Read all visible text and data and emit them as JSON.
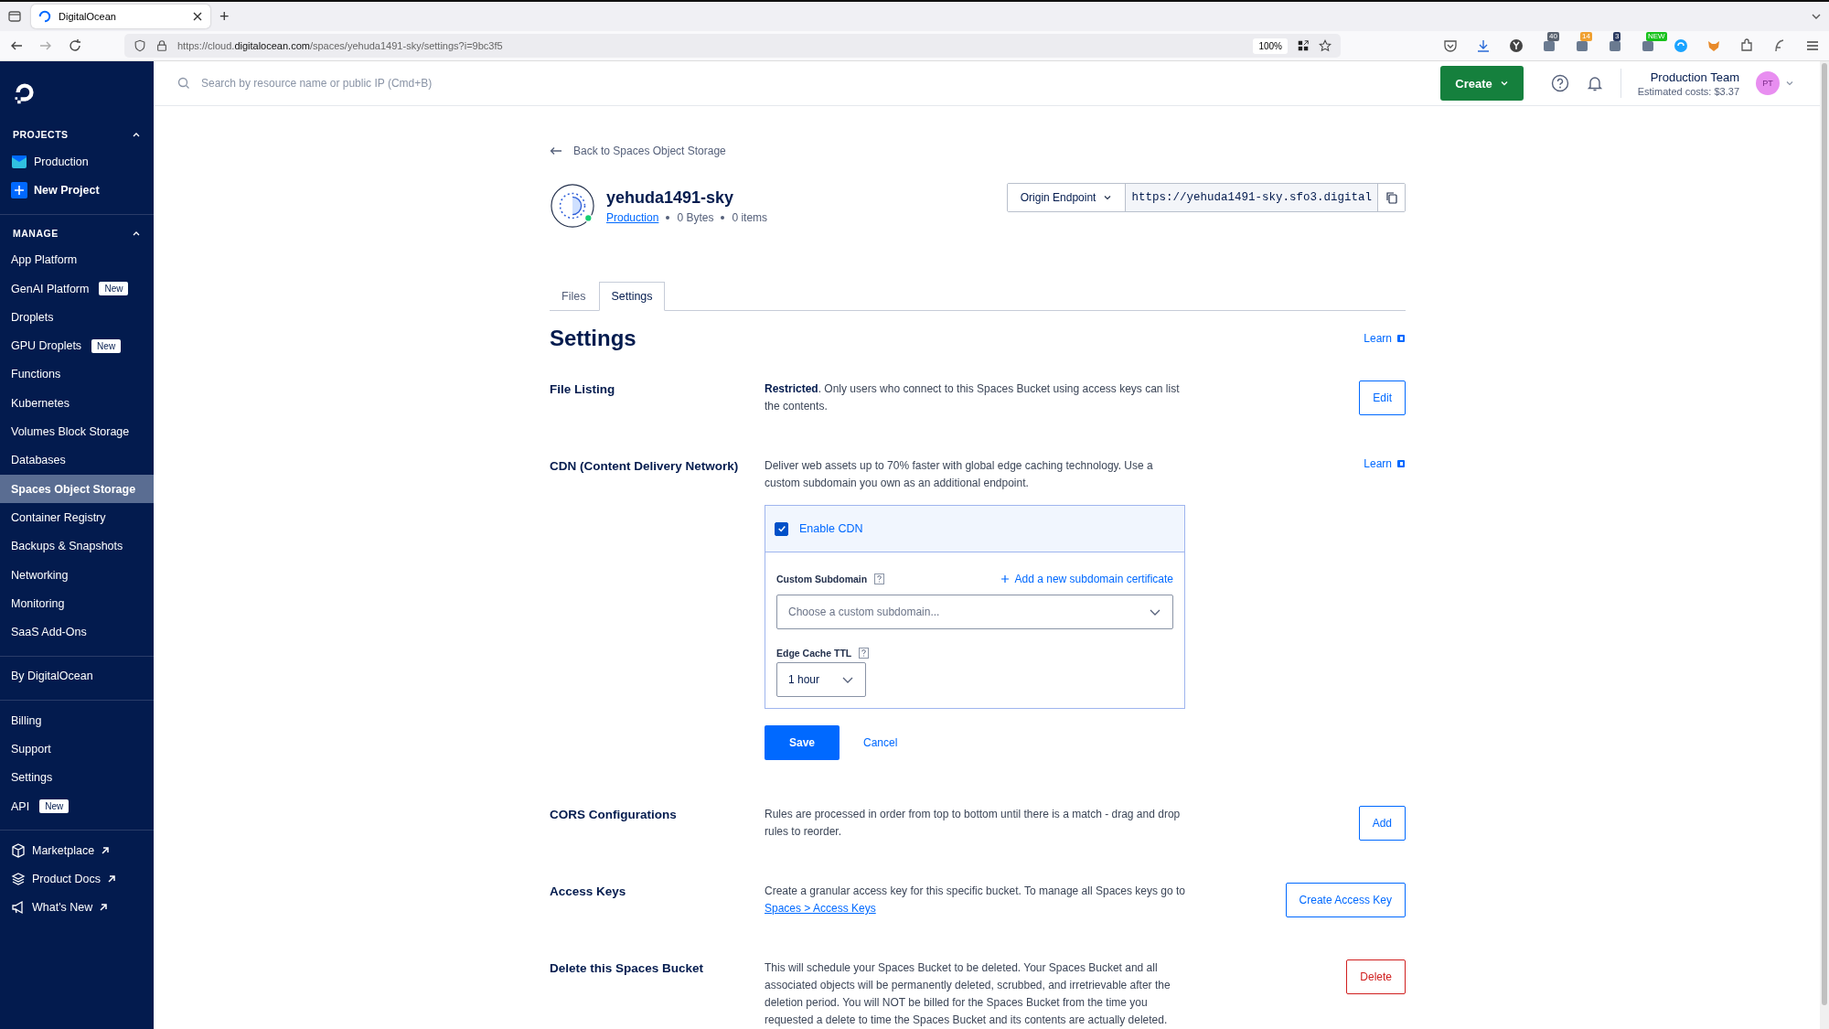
{
  "browser": {
    "tab_title": "DigitalOcean",
    "new_tab": "+",
    "url_prefix": "https://cloud.",
    "url_domain": "digitalocean.com",
    "url_path": "/spaces/yehuda1491-sky/settings?i=9bc3f5",
    "zoom": "100%",
    "extension_badges": [
      {
        "text": "40",
        "color": "#5a6370"
      },
      {
        "text": "14",
        "color": "#f0a030"
      },
      {
        "text": "3",
        "color": "#2a3a60"
      },
      {
        "text": "NEW",
        "color": "#18c21c"
      }
    ]
  },
  "sidebar": {
    "groups": [
      {
        "title": "PROJECTS",
        "expanded": true,
        "items": [
          {
            "label": "Production",
            "kind": "project",
            "selected": false
          },
          {
            "label": "New Project",
            "kind": "new",
            "selected": false
          }
        ]
      },
      {
        "title": "MANAGE",
        "expanded": true,
        "items": [
          {
            "label": "App Platform",
            "selected": false
          },
          {
            "label": "GenAI Platform",
            "badge": "New",
            "selected": false
          },
          {
            "label": "Droplets",
            "selected": false
          },
          {
            "label": "GPU Droplets",
            "badge": "New",
            "selected": false
          },
          {
            "label": "Functions",
            "selected": false
          },
          {
            "label": "Kubernetes",
            "selected": false
          },
          {
            "label": "Volumes Block Storage",
            "selected": false
          },
          {
            "label": "Databases",
            "selected": false
          },
          {
            "label": "Spaces Object Storage",
            "selected": true
          },
          {
            "label": "Container Registry",
            "selected": false
          },
          {
            "label": "Backups & Snapshots",
            "selected": false
          },
          {
            "label": "Networking",
            "selected": false
          },
          {
            "label": "Monitoring",
            "selected": false
          },
          {
            "label": "SaaS Add-Ons",
            "selected": false
          }
        ]
      },
      {
        "items": [
          {
            "label": "By DigitalOcean",
            "selected": false
          }
        ]
      },
      {
        "items": [
          {
            "label": "Billing",
            "selected": false
          },
          {
            "label": "Support",
            "selected": false
          },
          {
            "label": "Settings",
            "selected": false
          },
          {
            "label": "API",
            "badge": "New",
            "selected": false
          }
        ]
      },
      {
        "items": [
          {
            "label": "Marketplace",
            "kind": "marketplace",
            "external": true,
            "selected": false
          },
          {
            "label": "Product Docs",
            "kind": "docs",
            "external": true,
            "selected": false
          },
          {
            "label": "What's New",
            "kind": "news",
            "external": true,
            "selected": false
          }
        ]
      }
    ]
  },
  "header": {
    "search_placeholder": "Search by resource name or public IP (Cmd+B)",
    "create_button": "Create",
    "team": "Production Team",
    "costs": "Estimated costs: $3.37",
    "avatar": "PT"
  },
  "back_link": "Back to Spaces Object Storage",
  "bucket": {
    "name": "yehuda1491-sky",
    "project": "Production",
    "size": "0 Bytes",
    "items": "0 items",
    "endpoint_label": "Origin Endpoint",
    "endpoint_url": "https://yehuda1491-sky.sfo3.digital"
  },
  "tabs": [
    {
      "label": "Files",
      "selected": false
    },
    {
      "label": "Settings",
      "selected": true
    }
  ],
  "title": "Settings",
  "title_learn": "Learn",
  "sections": [
    {
      "kind": "simple",
      "label": "File Listing",
      "description": "**Restricted**. Only users who connect to this Spaces Bucket using access keys can list the contents.",
      "action": {
        "label": "Edit",
        "kind": "normal"
      }
    },
    {
      "kind": "cdn",
      "label": "CDN (Content Delivery Network)",
      "description": "Deliver web assets up to 70% faster with global edge caching technology. Use a custom subdomain you own as an additional endpoint.",
      "learn": "Learn",
      "enable": {
        "label": "Enable CDN",
        "checked": true
      },
      "subdomain_label": "Custom Subdomain",
      "add_certificate": "Add a new subdomain certificate",
      "subdomain_placeholder": "Choose a custom subdomain...",
      "ttl_label": "Edge Cache TTL",
      "ttl_value": "1 hour",
      "save": "Save",
      "cancel": "Cancel"
    },
    {
      "kind": "simple",
      "label": "CORS Configurations",
      "description": "Rules are processed in order from top to bottom until there is a match - drag and drop rules to reorder.",
      "action": {
        "label": "Add",
        "kind": "normal"
      }
    },
    {
      "kind": "simple",
      "label": "Access Keys",
      "description": "Create a granular access key for this specific bucket. To manage all Spaces keys go to",
      "link": "Spaces > Access Keys",
      "action": {
        "label": "Create Access Key",
        "kind": "normal"
      }
    },
    {
      "kind": "simple",
      "label": "Delete this Spaces Bucket",
      "description": "This will schedule your Spaces Bucket to be deleted. Your Spaces Bucket and all associated objects will be permanently deleted, scrubbed, and irretrievable after the deletion period. You will NOT be billed for the Spaces Bucket from the time you requested a delete to time the Spaces Bucket and its contents are actually deleted.",
      "action": {
        "label": "Delete",
        "kind": "danger"
      }
    }
  ]
}
